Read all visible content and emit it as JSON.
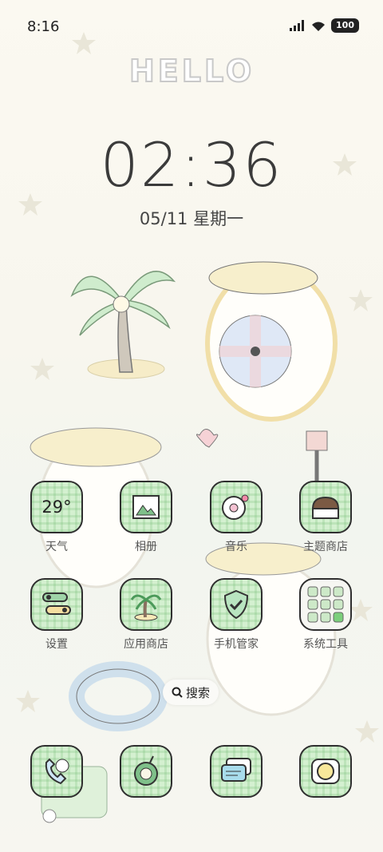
{
  "status": {
    "time": "8:16",
    "battery": "100"
  },
  "clock": {
    "time": "02:36",
    "date": "05/11 星期一"
  },
  "weather": {
    "temp": "29°"
  },
  "apps_row1": [
    {
      "label": "天气",
      "icon": "weather-icon"
    },
    {
      "label": "相册",
      "icon": "gallery-icon"
    },
    {
      "label": "音乐",
      "icon": "music-icon"
    },
    {
      "label": "主题商店",
      "icon": "theme-store-icon"
    }
  ],
  "apps_row2": [
    {
      "label": "设置",
      "icon": "settings-icon"
    },
    {
      "label": "应用商店",
      "icon": "app-store-icon"
    },
    {
      "label": "手机管家",
      "icon": "phone-manager-icon"
    },
    {
      "label": "系统工具",
      "icon": "system-tools-folder-icon"
    }
  ],
  "search": {
    "label": "搜索"
  },
  "dock": [
    {
      "icon": "phone-icon"
    },
    {
      "icon": "browser-icon"
    },
    {
      "icon": "messages-icon"
    },
    {
      "icon": "camera-icon"
    }
  ],
  "colors": {
    "tile_bg": "#d4f0d0",
    "tile_border": "#2f2f2f"
  }
}
